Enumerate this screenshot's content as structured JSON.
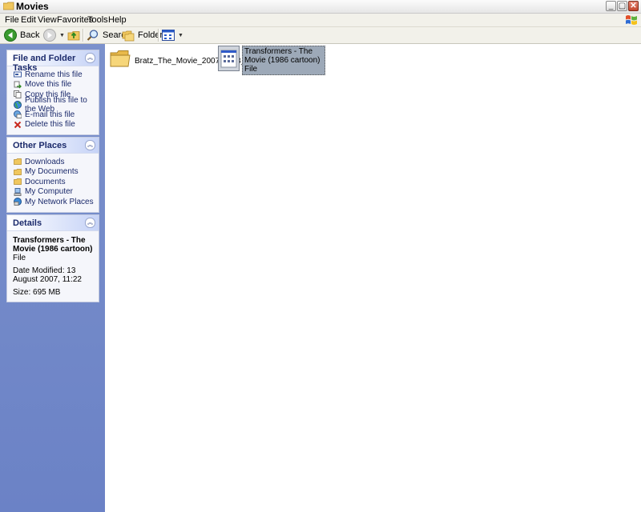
{
  "window": {
    "title": "Movies",
    "buttons": {
      "minimize": "_",
      "maximize": "▢",
      "close": "✕"
    }
  },
  "menu": [
    "File",
    "Edit",
    "View",
    "Favorites",
    "Tools",
    "Help"
  ],
  "toolbar": {
    "back": "Back",
    "search": "Search",
    "folders": "Folders"
  },
  "sidebar": {
    "file_tasks": {
      "title": "File and Folder Tasks",
      "items": [
        {
          "label": "Rename this file",
          "icon": "rename-icon"
        },
        {
          "label": "Move this file",
          "icon": "move-icon"
        },
        {
          "label": "Copy this file",
          "icon": "copy-icon"
        },
        {
          "label": "Publish this file to the Web",
          "icon": "globe-icon"
        },
        {
          "label": "E-mail this file",
          "icon": "email-icon"
        },
        {
          "label": "Delete this file",
          "icon": "delete-icon"
        }
      ]
    },
    "other_places": {
      "title": "Other Places",
      "items": [
        {
          "label": "Downloads",
          "icon": "folder-icon"
        },
        {
          "label": "My Documents",
          "icon": "folder-icon"
        },
        {
          "label": "Documents",
          "icon": "folder-icon"
        },
        {
          "label": "My Computer",
          "icon": "computer-icon"
        },
        {
          "label": "My Network Places",
          "icon": "network-icon"
        }
      ]
    },
    "details": {
      "title": "Details",
      "name": "Transformers - The Movie (1986 cartoon)",
      "type": "File",
      "modified": "Date Modified: 13 August 2007, 11:22",
      "size": "Size: 695 MB"
    }
  },
  "files": [
    {
      "name": "Bratz_The_Movie_2007_VOB_...",
      "kind": "folder"
    },
    {
      "name": "Transformers - The Movie (1986 cartoon)",
      "type": "File",
      "kind": "file",
      "selected": true
    }
  ],
  "colors": {
    "sidebar_bg": "#6e85cc",
    "panel_title": "#1b2a6b",
    "selection": "#9da9b8"
  }
}
